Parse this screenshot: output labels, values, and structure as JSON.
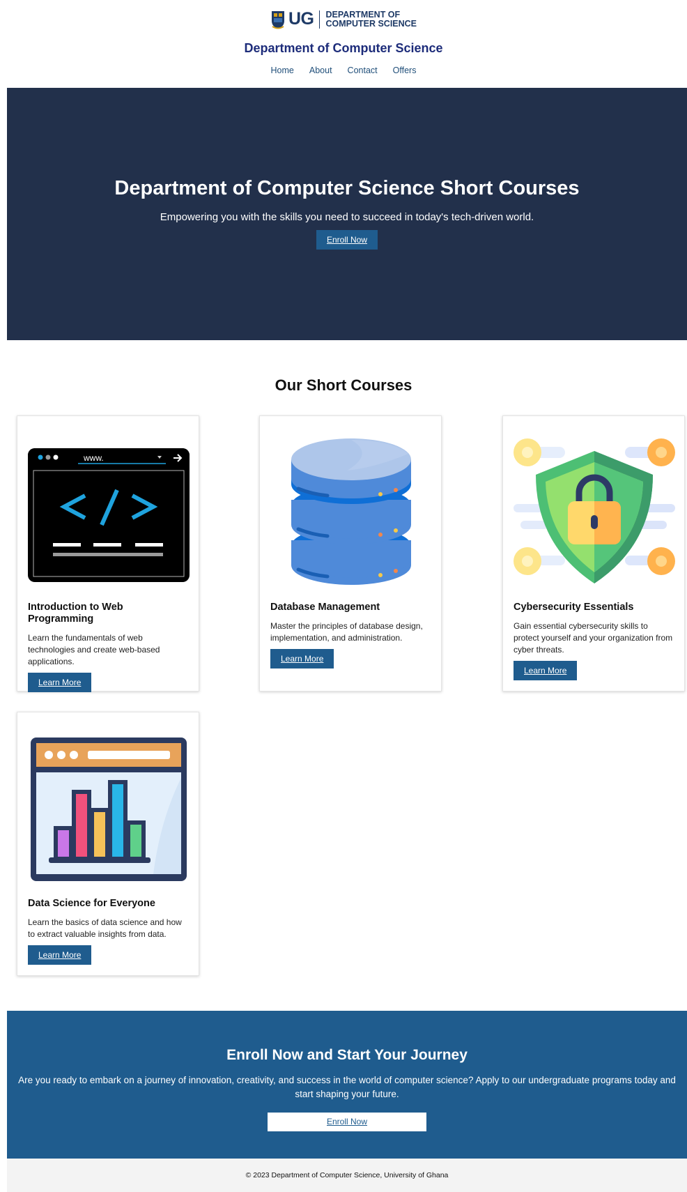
{
  "header": {
    "logo_ug": "UG",
    "logo_dept_line1": "DEPARTMENT OF",
    "logo_dept_line2": "COMPUTER SCIENCE",
    "site_title": "Department of Computer Science",
    "nav": [
      {
        "label": "Home"
      },
      {
        "label": "About"
      },
      {
        "label": "Contact"
      },
      {
        "label": "Offers"
      }
    ]
  },
  "hero": {
    "title": "Department of Computer Science Short Courses",
    "subtitle": "Empowering you with the skills you need to succeed in today's tech-driven world.",
    "button": "Enroll Now"
  },
  "courses": {
    "title": "Our Short Courses",
    "items": [
      {
        "icon": "web-programming-icon",
        "title": "Introduction to Web Programming",
        "desc": "Learn the fundamentals of web technologies and create web-based applications.",
        "button": "Learn More",
        "url_text": "www."
      },
      {
        "icon": "database-icon",
        "title": "Database Management",
        "desc": "Master the principles of database design, implementation, and administration.",
        "button": "Learn More"
      },
      {
        "icon": "security-shield-icon",
        "title": "Cybersecurity Essentials",
        "desc": "Gain essential cybersecurity skills to protect yourself and your organization from cyber threats.",
        "button": "Learn More"
      },
      {
        "icon": "data-chart-icon",
        "title": "Data Science for Everyone",
        "desc": "Learn the basics of data science and how to extract valuable insights from data.",
        "button": "Learn More"
      }
    ]
  },
  "enroll": {
    "title": "Enroll Now and Start Your Journey",
    "text": "Are you ready to embark on a journey of innovation, creativity, and success in the world of computer science? Apply to our undergraduate programs today and start shaping your future.",
    "button": "Enroll Now"
  },
  "footer": {
    "text": "© 2023 Department of Computer Science, University of Ghana"
  },
  "colors": {
    "hero_bg": "#22304b",
    "accent": "#1f5c8e",
    "title_blue": "#1d2c7a",
    "footer_bg": "#f3f3f3"
  }
}
